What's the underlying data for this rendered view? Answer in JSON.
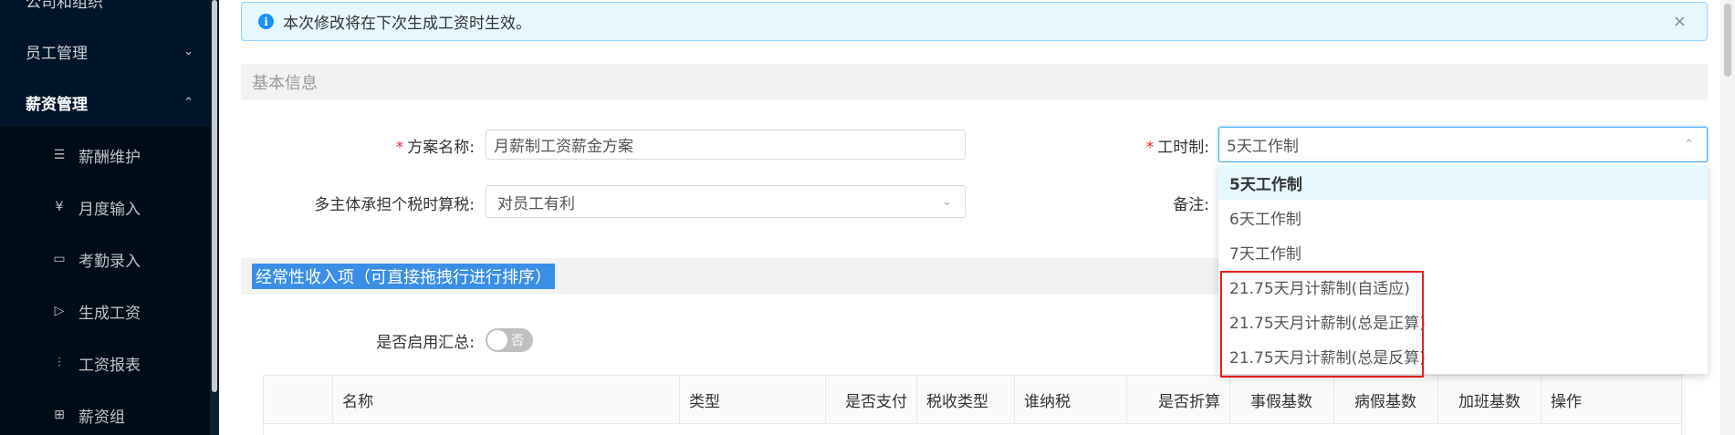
{
  "sidebar": {
    "top_partial": "公司和组织",
    "items": [
      {
        "label": "员工管理",
        "chevron": "⌄"
      },
      {
        "label": "薪资管理",
        "chevron": "⌃"
      }
    ],
    "subitems": [
      {
        "label": "薪酬维护",
        "icon": "☰"
      },
      {
        "label": "月度输入",
        "icon": "¥"
      },
      {
        "label": "考勤录入",
        "icon": "▭"
      },
      {
        "label": "生成工资",
        "icon": "▷"
      },
      {
        "label": "工资报表",
        "icon": "⫶"
      },
      {
        "label": "薪资组",
        "icon": "⊞"
      }
    ]
  },
  "alert": {
    "message": "本次修改将在下次生成工资时生效。",
    "info_icon": "i",
    "close_icon": "×"
  },
  "basic_section": {
    "title": "基本信息"
  },
  "form": {
    "scheme_name": {
      "label": "方案名称:",
      "value": "月薪制工资薪金方案"
    },
    "tax_mode": {
      "label": "多主体承担个税时算税:",
      "value": "对员工有利",
      "chevron": "⌄"
    },
    "work_hours": {
      "label": "工时制:",
      "value": "5天工作制",
      "chevron": "⌃"
    },
    "note": {
      "label": "备注:"
    }
  },
  "dropdown": {
    "options": [
      "5天工作制",
      "6天工作制",
      "7天工作制",
      "21.75天月计薪制(自适应)",
      "21.75天月计薪制(总是正算)",
      "21.75天月计薪制(总是反算)"
    ],
    "selected_index": 0
  },
  "income_section": {
    "title": "经常性收入项（可直接拖拽行进行排序）"
  },
  "summary": {
    "label": "是否启用汇总:",
    "toggle_text": "否",
    "enabled": false
  },
  "table": {
    "columns": [
      "",
      "名称",
      "类型",
      "是否支付",
      "税收类型",
      "谁纳税",
      "是否折算",
      "事假基数",
      "病假基数",
      "加班基数",
      "操作"
    ]
  },
  "colors": {
    "sidebar_bg": "#001529",
    "accent": "#1890ff",
    "required": "#f5222d",
    "highlight_box": "#e11d1d"
  }
}
